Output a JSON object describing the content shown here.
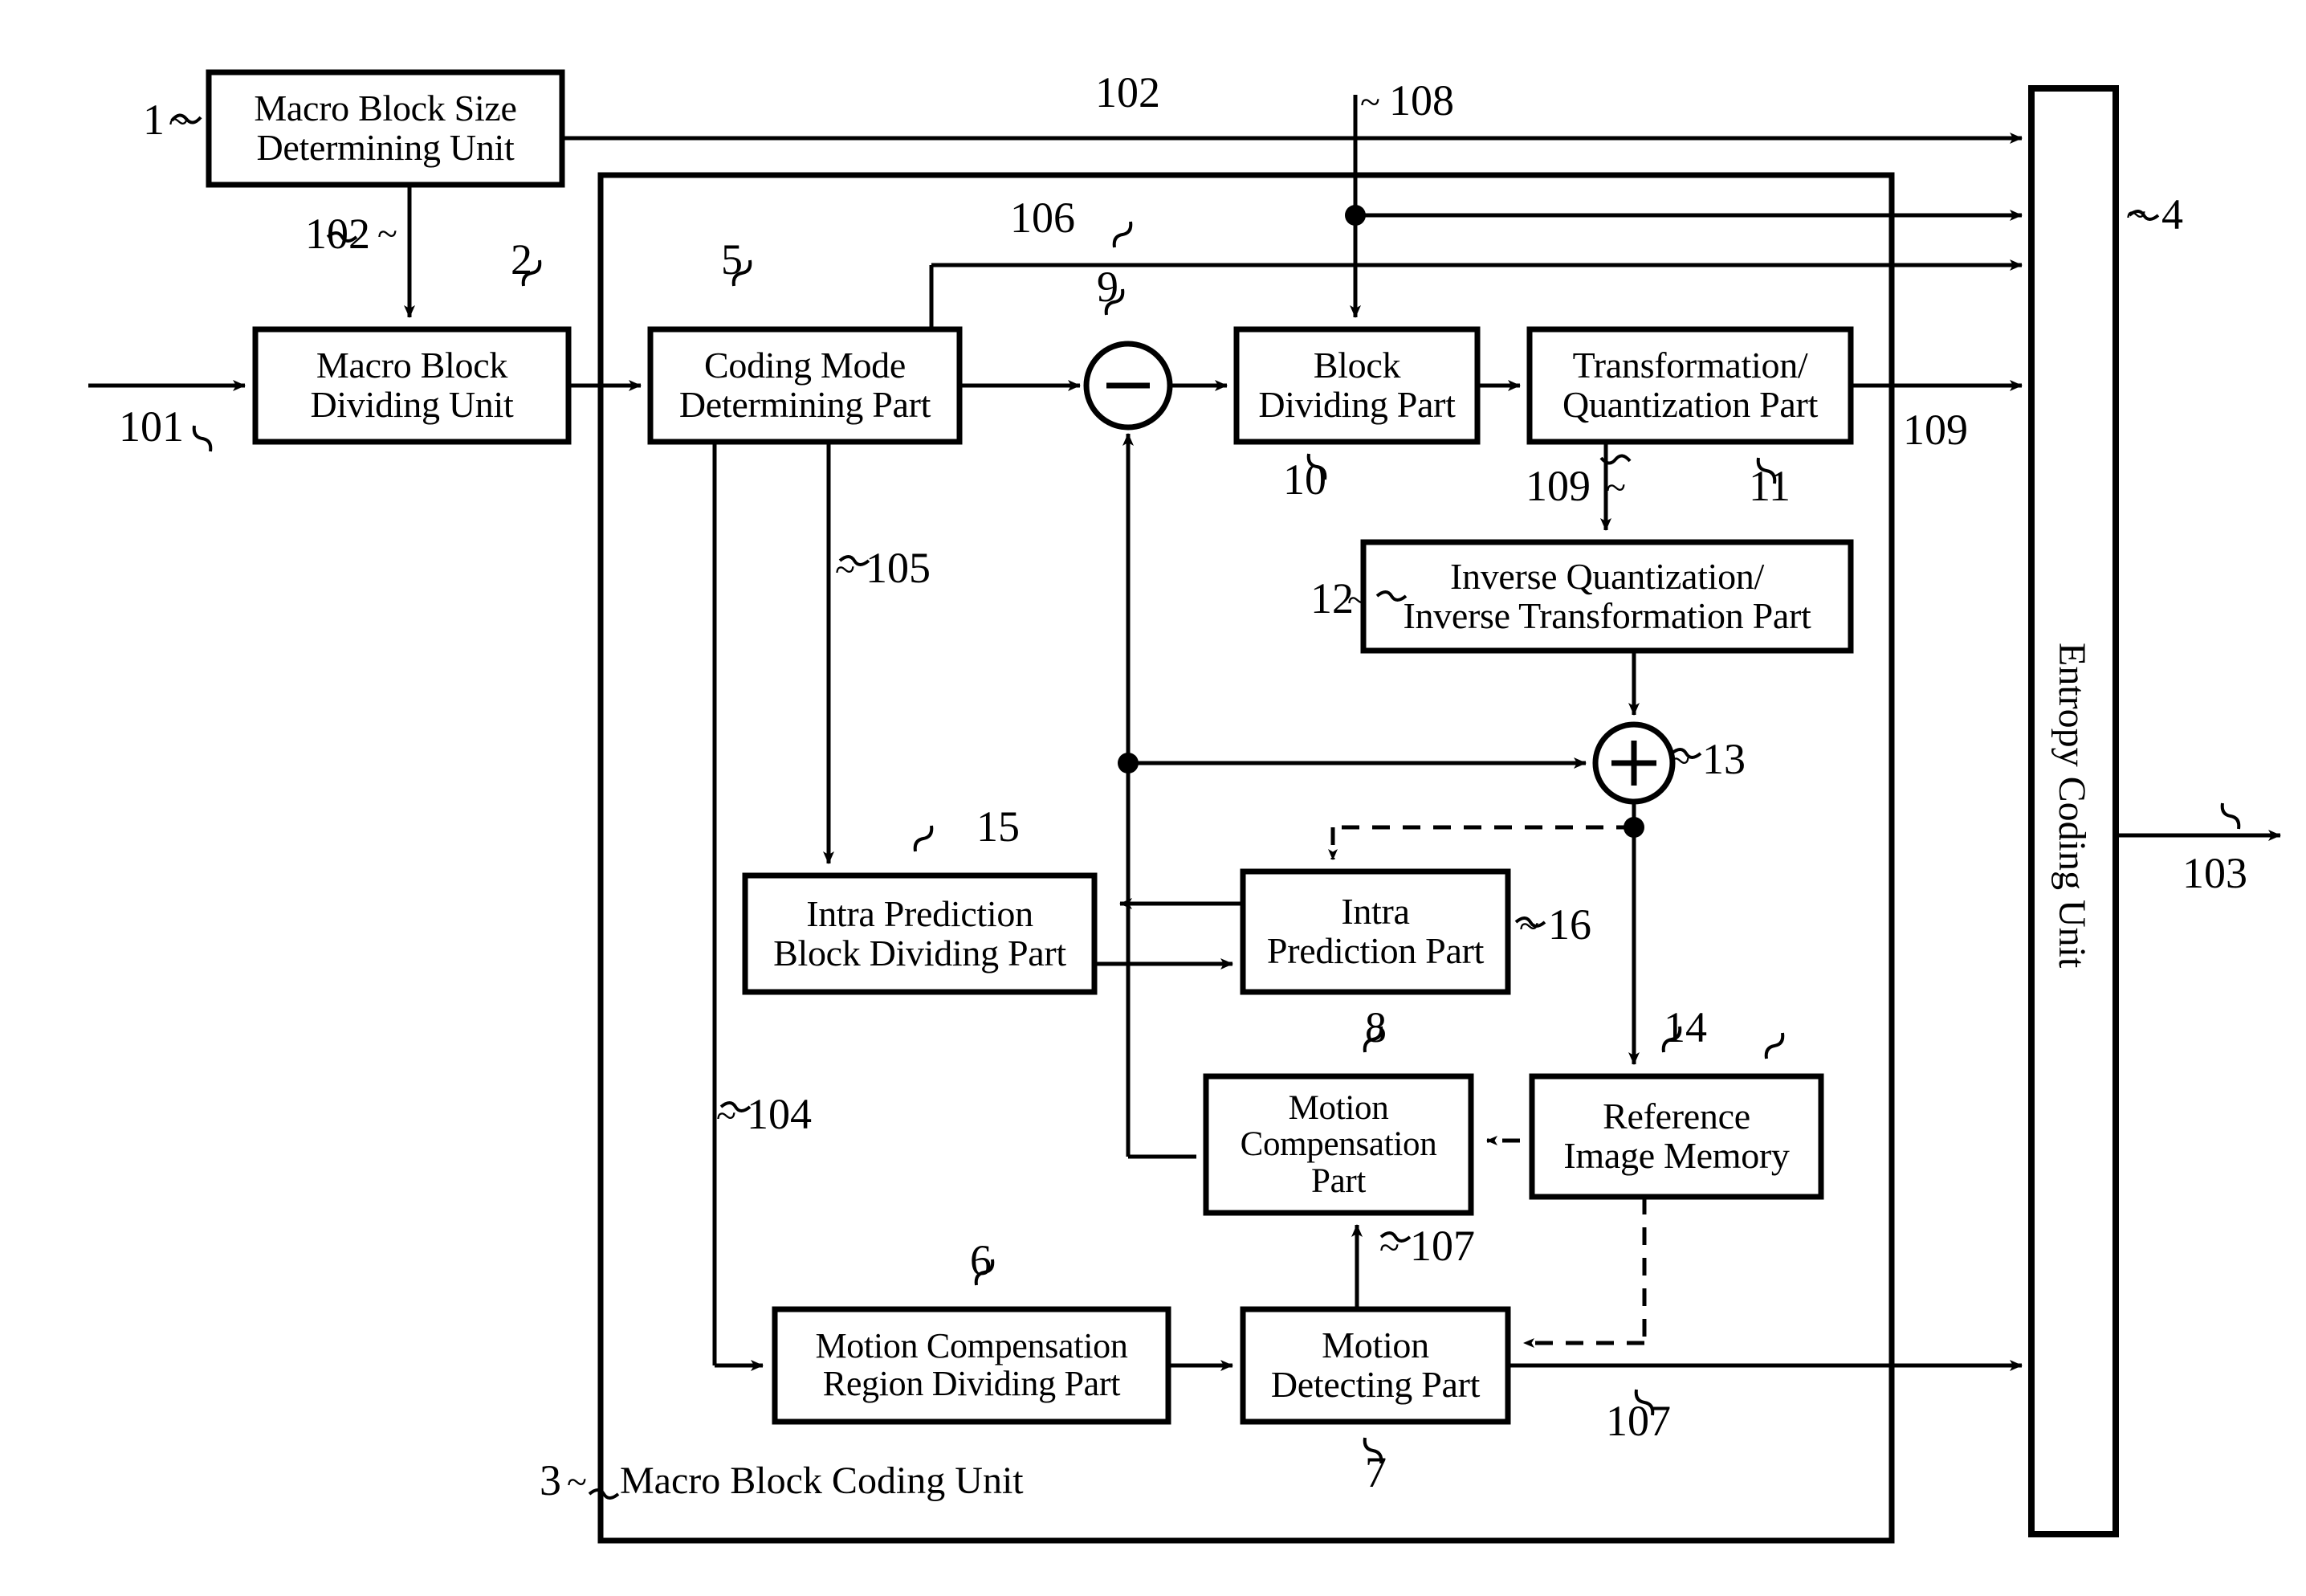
{
  "figure": {
    "type": "block-diagram",
    "domain": "patent-figure",
    "description": "Video encoder block diagram with macro block size determining unit, macro block coding unit and entropy coding unit"
  },
  "blocks": {
    "macro_block_size_determining_unit": {
      "label": "Macro Block Size\nDetermining Unit",
      "ref": "1"
    },
    "macro_block_dividing_unit": {
      "label": "Macro Block\nDividing Unit",
      "ref": "2"
    },
    "coding_mode_determining_part": {
      "label": "Coding Mode\nDetermining Part",
      "ref": "5"
    },
    "block_dividing_part": {
      "label": "Block\nDividing Part",
      "ref": "10"
    },
    "transformation_quantization_part": {
      "label": "Transformation/\nQuantization Part",
      "ref": "11"
    },
    "inverse_quantization_part": {
      "label": "Inverse Quantization/\nInverse Transformation Part",
      "ref": "12"
    },
    "intra_prediction_block_dividing_part": {
      "label": "Intra Prediction\nBlock Dividing Part",
      "ref": "15"
    },
    "intra_prediction_part": {
      "label": "Intra\nPrediction Part",
      "ref": "16"
    },
    "motion_compensation_part": {
      "label": "Motion\nCompensation\nPart",
      "ref": "8"
    },
    "reference_image_memory": {
      "label": "Reference\nImage Memory",
      "ref": "14"
    },
    "motion_compensation_region_dividing_part": {
      "label": "Motion Compensation\nRegion Dividing Part",
      "ref": "6"
    },
    "motion_detecting_part": {
      "label": "Motion\nDetecting Part",
      "ref": "7"
    },
    "entropy_coding_unit": {
      "label": "Entropy Coding Unit",
      "ref": "4"
    },
    "macro_block_coding_unit": {
      "label": "Macro Block Coding Unit",
      "ref": "3"
    }
  },
  "operators": {
    "subtractor": {
      "symbol": "−",
      "ref": "9"
    },
    "adder": {
      "symbol": "+",
      "ref": "13"
    }
  },
  "signals": {
    "input_image": "101",
    "macro_block_size": "102",
    "macro_block_size_top": "102",
    "bitstream_output": "103",
    "coding_mode_motion": "104",
    "coding_mode_intra": "105",
    "coding_mode_signal": "106",
    "motion_vector": "107",
    "motion_vector_top": "107",
    "quantization_param": "108",
    "coefficients": "109",
    "coefficients_right": "109"
  },
  "refs": {
    "n1": "1",
    "n2": "2",
    "n3": "3",
    "n4": "4",
    "n5": "5",
    "n6": "6",
    "n7": "7",
    "n8": "8",
    "n9": "9",
    "n10": "10",
    "n11": "11",
    "n12": "12",
    "n13": "13",
    "n14": "14",
    "n15": "15",
    "n16": "16"
  },
  "colors": {
    "stroke": "#000000",
    "background": "#ffffff"
  }
}
